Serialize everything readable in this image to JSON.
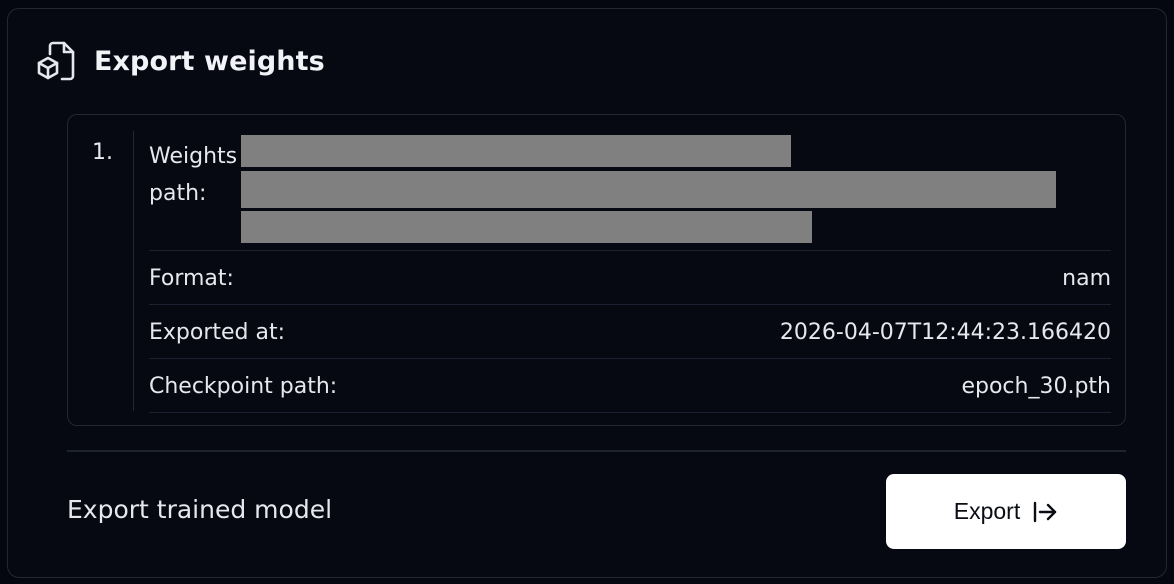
{
  "header": {
    "title": "Export weights",
    "icon": "file-box-icon"
  },
  "item": {
    "index": "1.",
    "weights_path_label": "Weights path:",
    "fields": [
      {
        "label": "Format:",
        "value": "nam"
      },
      {
        "label": "Exported at:",
        "value": "2026-04-07T12:44:23.166420"
      },
      {
        "label": "Checkpoint path:",
        "value": "epoch_30.pth"
      }
    ]
  },
  "footer": {
    "label": "Export trained model",
    "button_label": "Export",
    "button_icon": "arrow-right-to-line-icon"
  },
  "colors": {
    "background": "#050710",
    "border": "#232734",
    "redaction": "#808080",
    "button_bg": "#ffffff"
  }
}
